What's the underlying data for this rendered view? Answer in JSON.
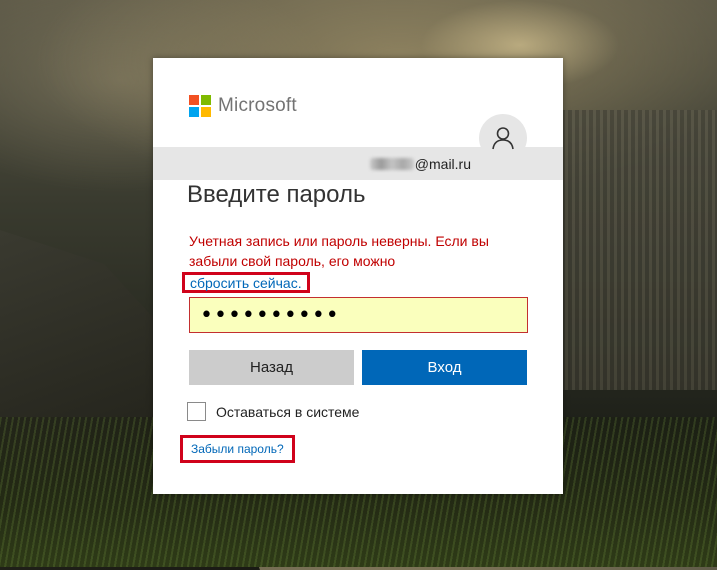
{
  "brand": {
    "name": "Microsoft",
    "colors": [
      "#f25022",
      "#7fba00",
      "#00a4ef",
      "#ffb900"
    ]
  },
  "account": {
    "email_domain": "@mail.ru",
    "avatar_icon": "person-icon"
  },
  "form": {
    "title": "Введите пароль",
    "error_text": "Учетная запись или пароль неверны. Если вы забыли свой пароль, его можно",
    "reset_link": "сбросить сейчас.",
    "password_value": "••••••••••",
    "back_button": "Назад",
    "signin_button": "Вход",
    "remember_label": "Оставаться в системе",
    "forgot_link": "Забыли пароль?"
  },
  "colors": {
    "accent": "#0067b8",
    "error": "#c00000",
    "highlight_border": "#d0021b"
  }
}
